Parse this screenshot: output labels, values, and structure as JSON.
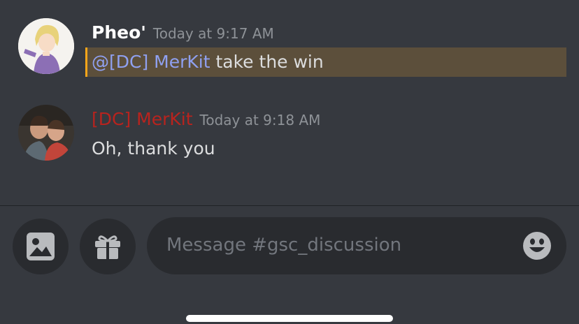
{
  "messages": [
    {
      "username": "Pheo'",
      "timestamp": "Today at 9:17 AM",
      "mention": "@[DC] MerKit",
      "text": " take the win",
      "avatar_icon": "anime-character-avatar"
    },
    {
      "username": "[DC] MerKit",
      "timestamp": "Today at 9:18 AM",
      "text": "Oh, thank you",
      "avatar_icon": "photo-avatar",
      "username_color": "#b8231e"
    }
  ],
  "composer": {
    "placeholder": "Message #gsc_discussion",
    "image_icon": "image-icon",
    "gift_icon": "gift-icon",
    "emoji_icon": "emoji-icon"
  },
  "colors": {
    "background": "#36393f",
    "mention_highlight": "#5c4f3b",
    "mention_bar": "#faa61a",
    "mention_text": "#8fa0f0"
  }
}
